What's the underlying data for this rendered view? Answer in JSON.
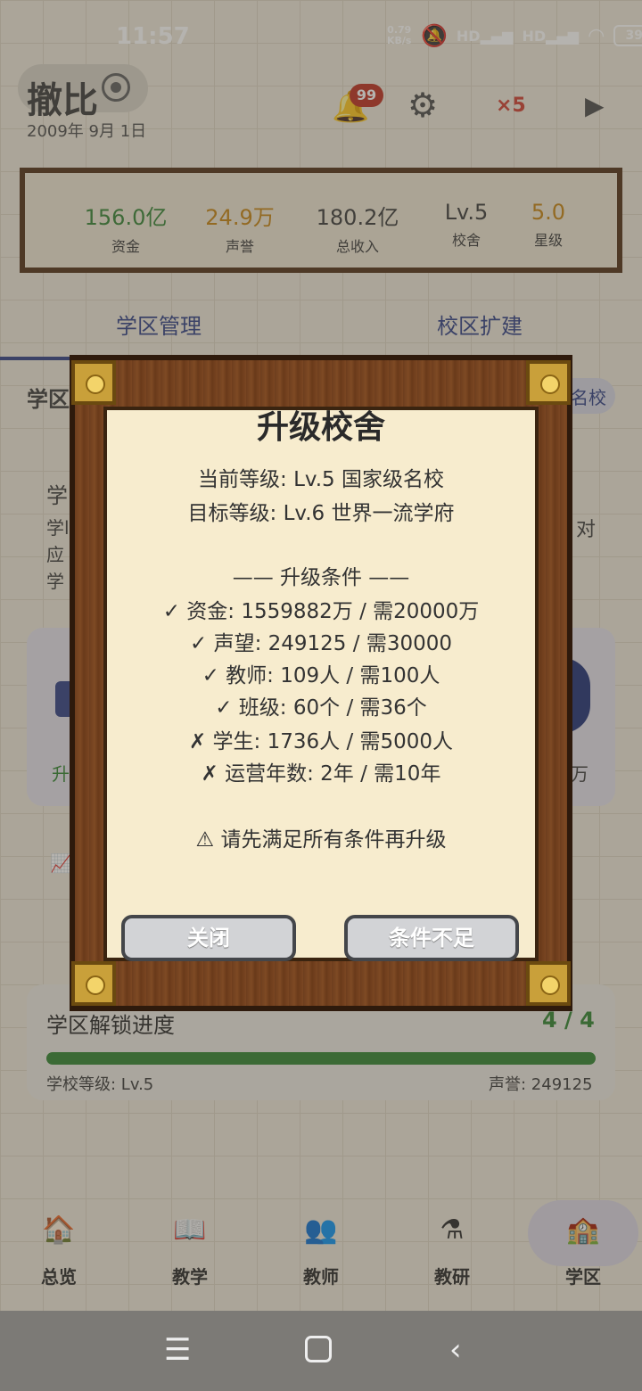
{
  "status_bar": {
    "time": "11:57",
    "net_speed": "0.79",
    "net_unit": "KB/s",
    "signal1": "HD",
    "signal2": "HD",
    "battery": "39"
  },
  "header": {
    "title": "撤比",
    "date": "2009年 9月 1日",
    "notification_count": "99",
    "speed": "×5"
  },
  "stats": [
    {
      "value": "156.0亿",
      "label": "资金",
      "color": "#3f8a3f"
    },
    {
      "value": "24.9万",
      "label": "声誉",
      "color": "#c98a1e"
    },
    {
      "value": "180.2亿",
      "label": "总收入",
      "color": "#444444"
    },
    {
      "value": "Lv.5",
      "label": "校舍",
      "color": "#444444"
    },
    {
      "value": "5.0",
      "label": "星级",
      "color": "#c98a1e"
    }
  ],
  "tabs": [
    "学区管理",
    "校区扩建"
  ],
  "background": {
    "section_title": "学区",
    "right_badge": "名校",
    "line_a": "学",
    "line_b": "学l",
    "line_c": "应",
    "line_d": "学",
    "right_text": "对",
    "card_left_text": "升",
    "card_right_text": "万"
  },
  "progress": {
    "title": "学区解锁进度",
    "count": "4 / 4",
    "left": "学校等级: Lv.5",
    "right": "声誉: 249125",
    "fraction": 1.0
  },
  "nav": [
    {
      "label": "总览",
      "icon": "school-house-icon"
    },
    {
      "label": "教学",
      "icon": "book-icon"
    },
    {
      "label": "教师",
      "icon": "teachers-icon"
    },
    {
      "label": "教研",
      "icon": "flask-icon"
    },
    {
      "label": "学区",
      "icon": "campus-icon"
    }
  ],
  "dialog": {
    "title": "升级校舍",
    "current_level": "当前等级: Lv.5 国家级名校",
    "target_level": "目标等级: Lv.6 世界一流学府",
    "conditions_header": "—— 升级条件 ——",
    "conditions": [
      "✓ 资金: 1559882万 / 需20000万",
      "✓ 声望: 249125 / 需30000",
      "✓ 教师: 109人 / 需100人",
      "✓ 班级: 60个 / 需36个",
      "✗ 学生: 1736人 / 需5000人",
      "✗ 运营年数: 2年 / 需10年"
    ],
    "warning": "⚠ 请先满足所有条件再升级",
    "close_label": "关闭",
    "confirm_label": "条件不足"
  }
}
